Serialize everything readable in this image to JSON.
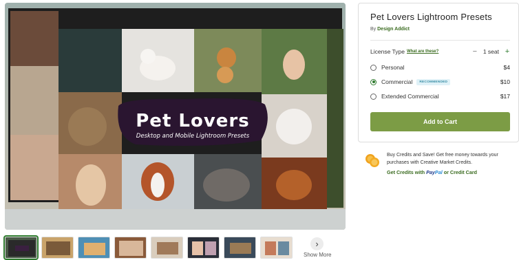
{
  "preview": {
    "title_line": "Pet Lovers",
    "subtitle_line": "Desktop and Mobile Lightroom Presets"
  },
  "thumbnails": {
    "count": 8,
    "more_label": "Show More",
    "more_icon": "chevron-right-icon"
  },
  "product": {
    "title": "Pet Lovers Lightroom Presets",
    "by_prefix": "By",
    "author": "Design Addict",
    "license_label": "License Type",
    "whats_these": "What are these?",
    "qty_minus": "−",
    "qty_value": "1 seat",
    "qty_plus": "+",
    "licenses": [
      {
        "label": "Personal",
        "price": "$4",
        "selected": false
      },
      {
        "label": "Commercial",
        "price": "$10",
        "selected": true,
        "badge": "RECOMMENDED"
      },
      {
        "label": "Extended Commercial",
        "price": "$17",
        "selected": false
      }
    ],
    "add_to_cart": "Add to Cart"
  },
  "credits": {
    "text": "Buy Credits and Save! Get free money towards your purchases with Creative Market Credits.",
    "link_prefix": "Get Credits with",
    "paypal_a": "Pay",
    "paypal_b": "Pal",
    "link_suffix": "or Credit Card",
    "icon": "coins-icon"
  },
  "colors": {
    "accent_green": "#7c9c45",
    "link_green": "#3a6b1f",
    "badge_bg": "#dff1f7",
    "badge_text": "#3b8ea6"
  }
}
